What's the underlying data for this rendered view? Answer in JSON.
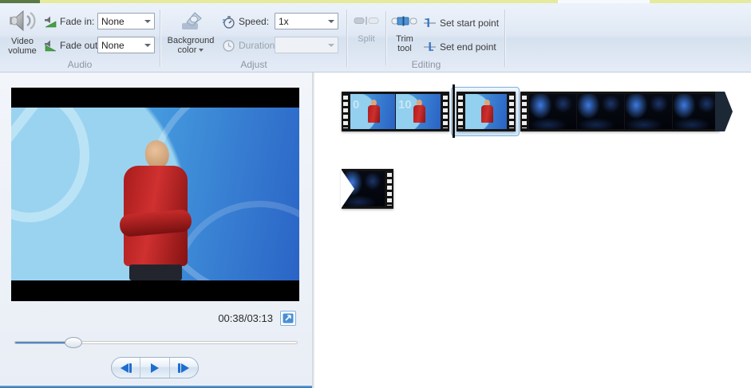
{
  "ribbon": {
    "audio": {
      "group_label": "Audio",
      "video_volume_label": "Video volume",
      "fade_in_label": "Fade in:",
      "fade_in_value": "None",
      "fade_out_label": "Fade out:",
      "fade_out_value": "None"
    },
    "adjust": {
      "group_label": "Adjust",
      "background_color_label": "Background color",
      "speed_label": "Speed:",
      "speed_value": "1x",
      "duration_label": "Duration:",
      "duration_value": ""
    },
    "editing": {
      "group_label": "Editing",
      "split_label": "Split",
      "trim_tool_label": "Trim tool",
      "set_start_point_label": "Set start point",
      "set_end_point_label": "Set end point"
    }
  },
  "preview": {
    "time_display": "00:38/03:13",
    "progress_percent": 19
  },
  "storyboard": {
    "clip1": {
      "frame1_number": "0",
      "frame2_number": "10"
    }
  },
  "colors": {
    "accent_blue": "#2e75c1",
    "selection_border": "#7fb0de",
    "playhead": "#141414",
    "ribbon_group_label": "#8d96a1",
    "fade_green": "#3f9b3f",
    "top_strip_yellow": "#e5ea9e"
  }
}
